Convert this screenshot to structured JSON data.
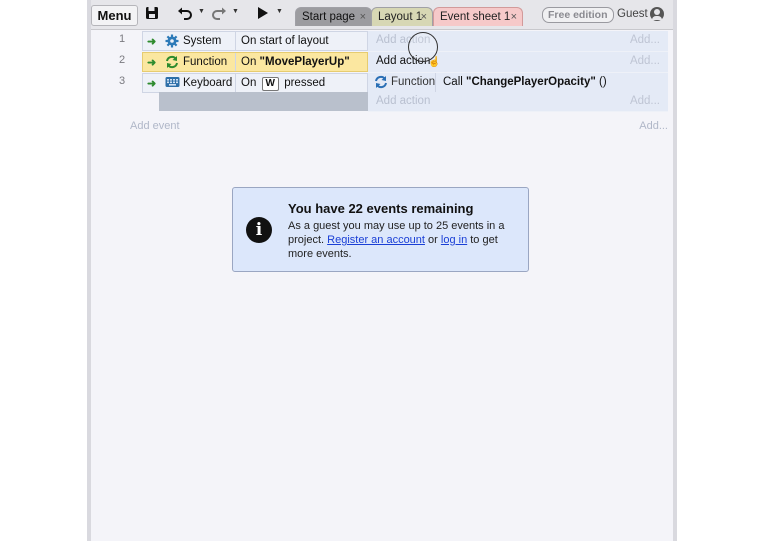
{
  "toolbar": {
    "menu_label": "Menu",
    "icons": [
      "save-icon",
      "undo-icon",
      "redo-icon",
      "play-icon"
    ],
    "tabs": [
      {
        "label": "Start page",
        "close": "×"
      },
      {
        "label": "Layout 1",
        "close": "×"
      },
      {
        "label": "Event sheet 1",
        "close": "×"
      }
    ],
    "free_edition": "Free edition",
    "guest_label": "Guest"
  },
  "events": [
    {
      "number": "1",
      "object": "System",
      "object_icon": "gear-icon",
      "condition": "On start of layout",
      "add_action": "Add action",
      "add_right": "Add..."
    },
    {
      "number": "2",
      "object": "Function",
      "object_icon": "function-icon",
      "condition_prefix": "On ",
      "condition_value": "\"MovePlayerUp\"",
      "add_action": "Add action",
      "add_right": "Add..."
    },
    {
      "number": "3",
      "object": "Keyboard",
      "object_icon": "keyboard-icon",
      "condition_prefix": "On",
      "condition_key": "W",
      "condition_suffix": "pressed",
      "action": {
        "object": "Function",
        "text_prefix": "Call ",
        "text_value": "\"ChangePlayerOpacity\"",
        "text_suffix": " ()"
      },
      "add_action": "Add action",
      "add_right": "Add..."
    }
  ],
  "add_event": "Add event",
  "add_event_right": "Add...",
  "notice": {
    "title": "You have 22 events remaining",
    "body_prefix": "As a guest you may use up to 25 events in a project. ",
    "register_link": "Register an account",
    "or_text": " or ",
    "login_link": "log in",
    "body_suffix": " to get more events."
  }
}
